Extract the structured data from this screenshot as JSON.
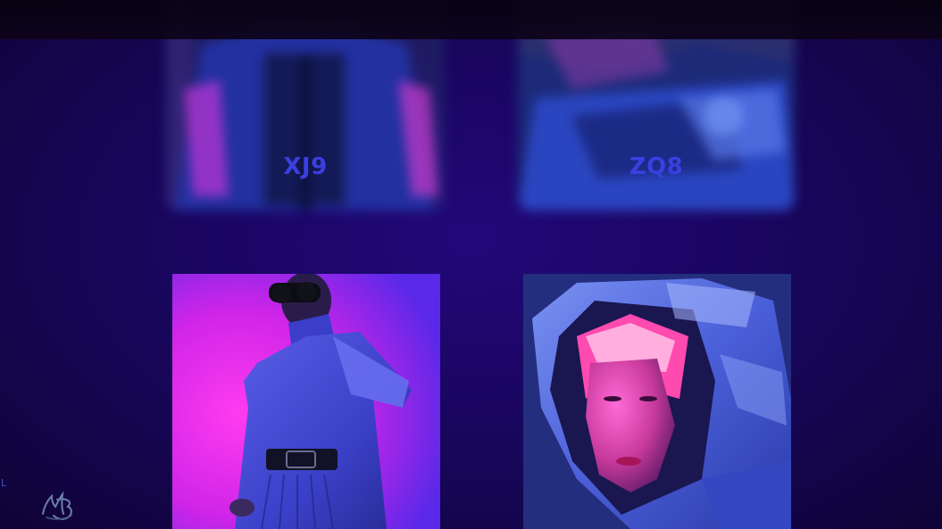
{
  "header": {
    "bar": "top-navigation-bar"
  },
  "gallery": {
    "top_row": [
      {
        "label": "XJ9",
        "image": "blurred-coat-figure-icon"
      },
      {
        "label": "ZQ8",
        "image": "blurred-hooded-figure-icon"
      }
    ],
    "bottom_row": [
      {
        "image": "model-in-sunglasses-trench-icon"
      },
      {
        "image": "hooded-model-portrait-icon"
      }
    ]
  },
  "footer": {
    "side_label": "L",
    "logo_text": "MB"
  },
  "colors": {
    "background": "#1a0662",
    "label": "#3b3fe0",
    "magenta": "#ff2ad4",
    "blue": "#3a4ae0"
  }
}
